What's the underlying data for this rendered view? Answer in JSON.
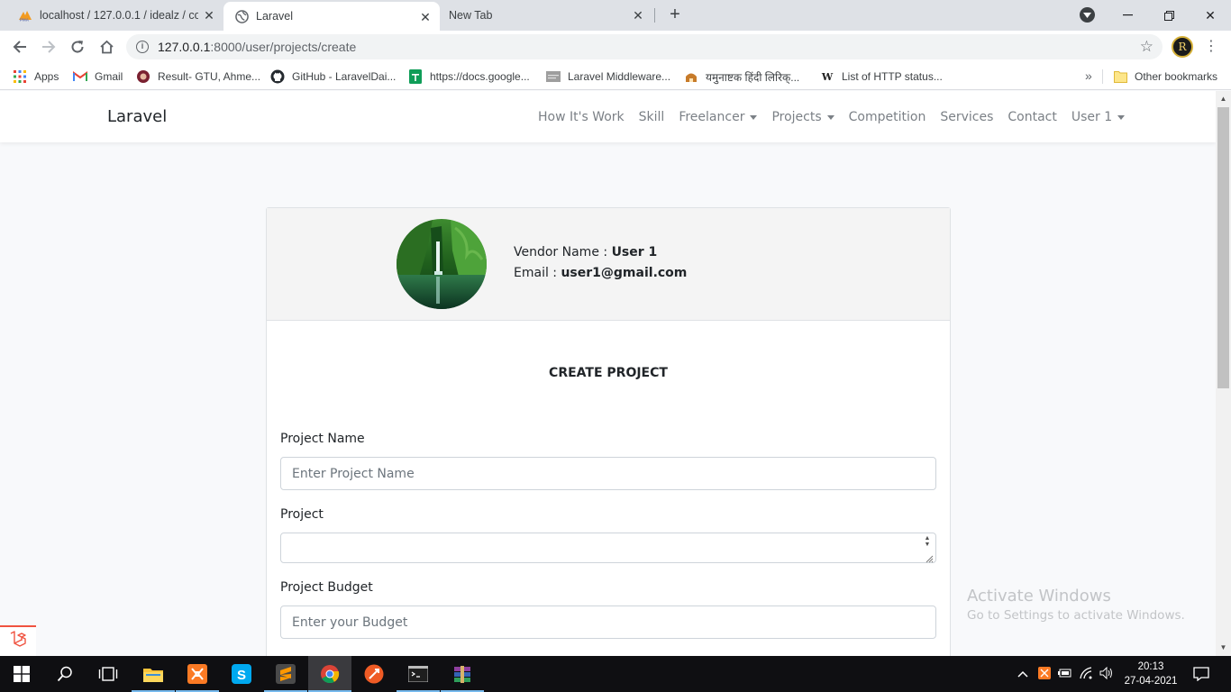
{
  "browser": {
    "tabs": [
      {
        "title": "localhost / 127.0.0.1 / idealz / co",
        "favicon": "phpmyadmin-icon"
      },
      {
        "title": "Laravel",
        "favicon": "globe-icon",
        "active": true
      },
      {
        "title": "New Tab"
      }
    ],
    "url_host": "127.0.0.1",
    "url_rest": ":8000/user/projects/create",
    "bookmarks": [
      {
        "label": "Apps",
        "icon": "apps-grid-icon"
      },
      {
        "label": "Gmail",
        "icon": "gmail-icon"
      },
      {
        "label": "Result- GTU, Ahme...",
        "icon": "gtu-icon"
      },
      {
        "label": "GitHub - LaravelDai...",
        "icon": "github-icon"
      },
      {
        "label": "https://docs.google...",
        "icon": "google-sheets-icon"
      },
      {
        "label": "Laravel Middleware...",
        "icon": "page-icon"
      },
      {
        "label": "यमुनाष्टक हिंदी लिरिक्...",
        "icon": "temple-icon"
      },
      {
        "label": "List of HTTP status...",
        "icon": "wikipedia-icon"
      }
    ],
    "other_bookmarks": "Other bookmarks",
    "wiki_glyph": "W"
  },
  "site": {
    "brand": "Laravel",
    "nav": [
      "How It's Work",
      "Skill",
      "Freelancer",
      "Projects",
      "Competition",
      "Services",
      "Contact",
      "User 1"
    ],
    "nav_dropdowns": [
      "Freelancer",
      "Projects",
      "User 1"
    ]
  },
  "profile": {
    "vendor_label": "Vendor Name : ",
    "vendor_name": "User 1",
    "email_label": "Email : ",
    "email": "user1@gmail.com"
  },
  "form": {
    "title": "CREATE PROJECT",
    "project_name_label": "Project Name",
    "project_name_placeholder": "Enter Project Name",
    "project_label": "Project",
    "project_value": "",
    "budget_label": "Project Budget",
    "budget_placeholder": "Enter your Budget"
  },
  "watermark": {
    "line1": "Activate Windows",
    "line2": "Go to Settings to activate Windows."
  },
  "taskbar": {
    "time": "20:13",
    "date": "27-04-2021",
    "apps": [
      "start-icon",
      "search-icon",
      "task-view-icon",
      "file-explorer-icon",
      "xampp-icon",
      "skype-icon",
      "sublime-text-icon",
      "chrome-icon",
      "postman-icon",
      "terminal-icon",
      "winrar-icon"
    ],
    "active_app": "chrome-icon"
  },
  "colors": {
    "tab_bar": "#dee1e6",
    "card_header": "#f4f4f4",
    "taskbar": "#0f0f12",
    "laravel_red": "#f05340"
  }
}
